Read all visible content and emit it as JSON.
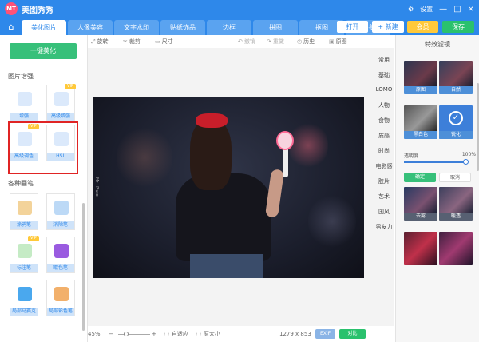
{
  "app": {
    "title": "美图秀秀",
    "logo_text": "MT"
  },
  "titlebar": {
    "settings": "设置",
    "minimize": "—",
    "maximize": "□",
    "close": "×"
  },
  "nav": {
    "home_icon": "home-icon",
    "tabs": [
      "美化图片",
      "人像美容",
      "文字水印",
      "贴纸饰品",
      "边框",
      "拼图",
      "抠图",
      "更多"
    ],
    "open": "打开",
    "new": "+ 新建",
    "vip": "会员",
    "save": "保存"
  },
  "left": {
    "one_click": "一键美化",
    "section_enhance": "图片增强",
    "tools_enhance": [
      {
        "label": "增强",
        "vip": false,
        "color": "#3b8be6"
      },
      {
        "label": "高级增强",
        "vip": true,
        "color": "#3b8be6"
      },
      {
        "label": "高级调色",
        "vip": true,
        "color": "#3b8be6"
      },
      {
        "label": "HSL",
        "vip": false,
        "color": "#3b8be6"
      }
    ],
    "section_brush": "各种画笔",
    "tools_brush": [
      {
        "label": "涂鸦笔",
        "vip": false,
        "color": "#e8a43c"
      },
      {
        "label": "消除笔",
        "vip": false,
        "color": "#4d9be9"
      },
      {
        "label": "标注笔",
        "vip": true,
        "color": "#5cc25c"
      },
      {
        "label": "取色笔",
        "vip": false,
        "color": "#9a5be0"
      },
      {
        "label": "局部马赛克",
        "vip": false,
        "color": "#2e9be6"
      },
      {
        "label": "局部彩色笔",
        "vip": false,
        "color": "#e0742a"
      }
    ],
    "vip_badge": "VIP"
  },
  "toolbar": {
    "rotate": "旋转",
    "crop": "裁剪",
    "size": "尺寸",
    "undo": "撤销",
    "redo": "重做",
    "history": "历史",
    "original": "原图"
  },
  "canvas": {
    "signature": "Mr · Pluto"
  },
  "bottom": {
    "zoom": "45%",
    "zoom_minus": "−",
    "zoom_plus": "+",
    "fit": "自适应",
    "actual": "原大小",
    "dimensions": "1279 x 853",
    "exif": "EXIF",
    "compare": "对比"
  },
  "categories": [
    "常用",
    "基础",
    "LOMO",
    "人物",
    "食物",
    "质感",
    "时尚",
    "电影感",
    "胶片",
    "艺术",
    "国风",
    "男友力"
  ],
  "right": {
    "title": "特效滤镜",
    "filters": [
      {
        "label": "原图",
        "state": "normal"
      },
      {
        "label": "自然",
        "state": "normal"
      },
      {
        "label": "黑白色",
        "state": "normal"
      },
      {
        "label": "锐化",
        "state": "selected"
      },
      {
        "label": "去雾",
        "state": "normal"
      },
      {
        "label": "暖透",
        "state": "normal"
      },
      {
        "label": "",
        "state": "normal"
      },
      {
        "label": "",
        "state": "normal"
      }
    ],
    "opacity_label": "透明度",
    "opacity_value": "100%",
    "opacity_level": 1.0,
    "ok": "确定",
    "cancel": "取消"
  }
}
